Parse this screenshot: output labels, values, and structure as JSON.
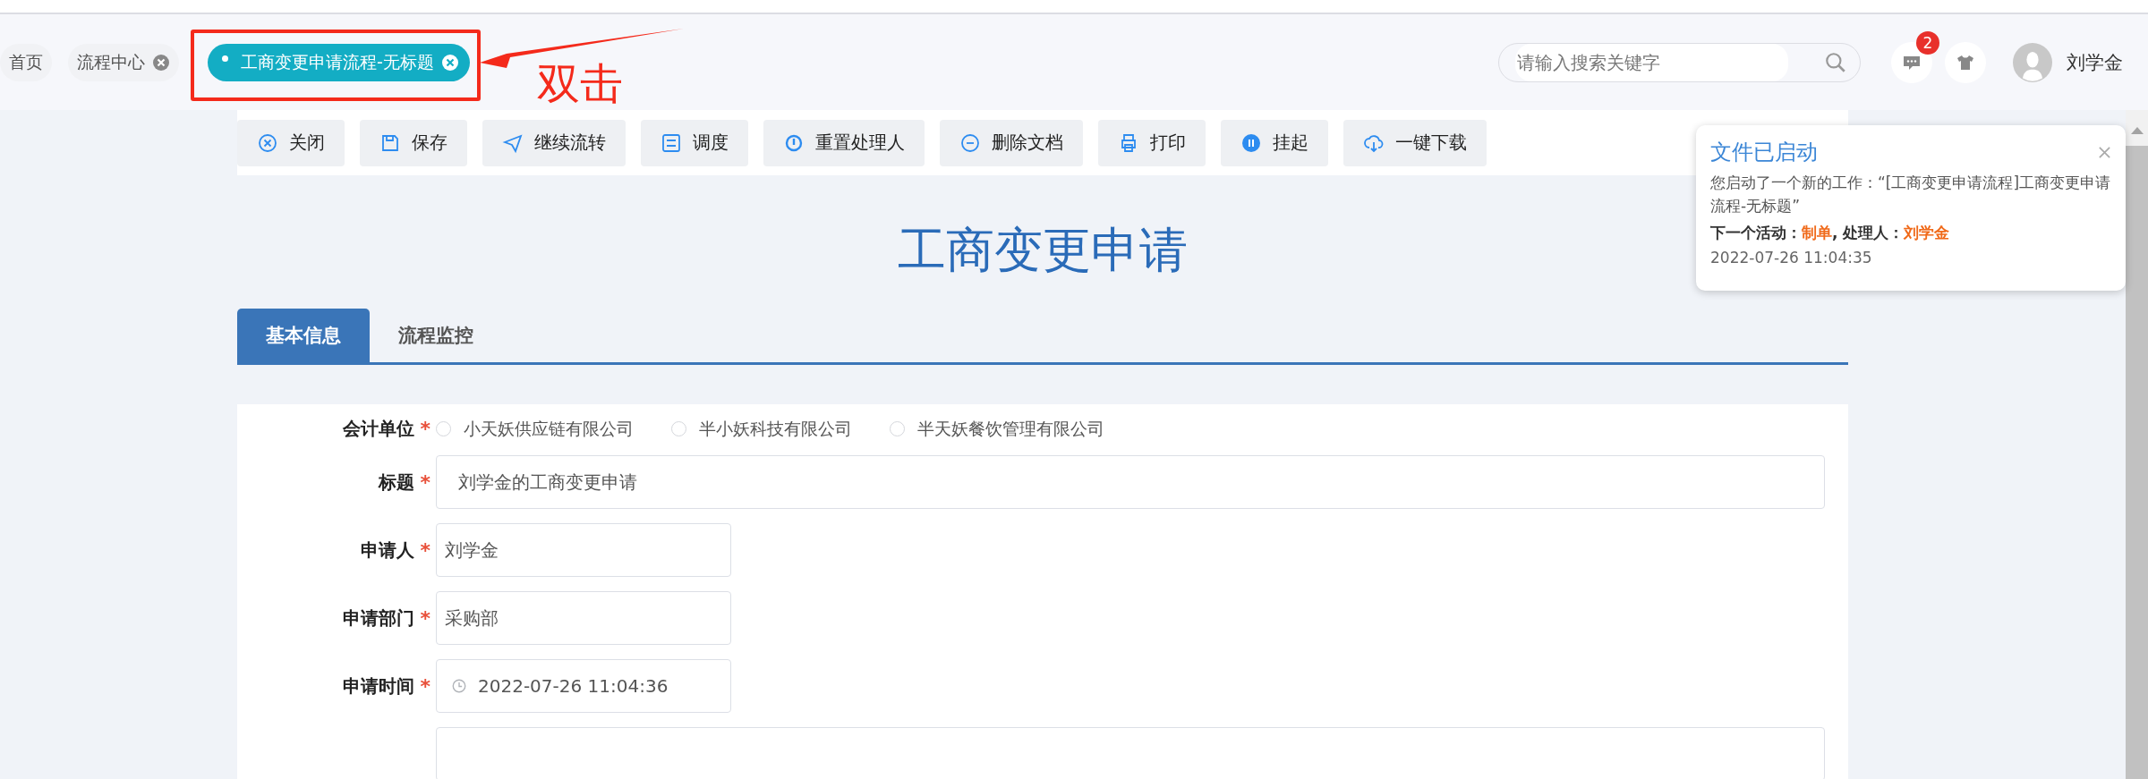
{
  "tabs": [
    {
      "label": "首页",
      "selected": false,
      "closable": false
    },
    {
      "label": "流程中心",
      "selected": false,
      "closable": true
    },
    {
      "label": "工商变更申请流程-无标题",
      "selected": true,
      "closable": true
    }
  ],
  "annotation": {
    "label": "双击"
  },
  "search": {
    "placeholder": "请输入搜索关键字"
  },
  "messages": {
    "badge": "2"
  },
  "user": {
    "name": "刘学金"
  },
  "toolbar": [
    "关闭",
    "保存",
    "继续流转",
    "调度",
    "重置处理人",
    "删除文档",
    "打印",
    "挂起",
    "一键下载"
  ],
  "form_title": "工商变更申请",
  "form_tabs": [
    {
      "label": "基本信息",
      "selected": true
    },
    {
      "label": "流程监控",
      "selected": false
    }
  ],
  "fields": [
    {
      "kind": "radio",
      "label": "会计单位",
      "required_mark": "*",
      "options": [
        {
          "label": "小天妖供应链有限公司",
          "selected": false
        },
        {
          "label": "半小妖科技有限公司",
          "selected": false
        },
        {
          "label": "半天妖餐饮管理有限公司",
          "selected": false
        }
      ]
    },
    {
      "kind": "wide",
      "label": "标题",
      "required_mark": "*",
      "value": "刘学金的工商变更申请"
    },
    {
      "kind": "text",
      "label": "申请人",
      "required_mark": "*",
      "value": "刘学金"
    },
    {
      "kind": "text",
      "label": "申请部门",
      "required_mark": "*",
      "value": "采购部"
    },
    {
      "kind": "date",
      "label": "申请时间",
      "required_mark": "*",
      "value": "2022-07-26 11:04:36"
    },
    {
      "kind": "blank"
    }
  ],
  "notification": {
    "title": "文件已启动",
    "message": "您启动了一个新的工作：“[工商变更申请流程]工商变更申请流程-无标题”",
    "next_label": "下一个活动：",
    "next_activity": "制单",
    "handler_label": ", 处理人：",
    "handler": "刘学金",
    "time": "2022-07-26 11:04:35"
  }
}
